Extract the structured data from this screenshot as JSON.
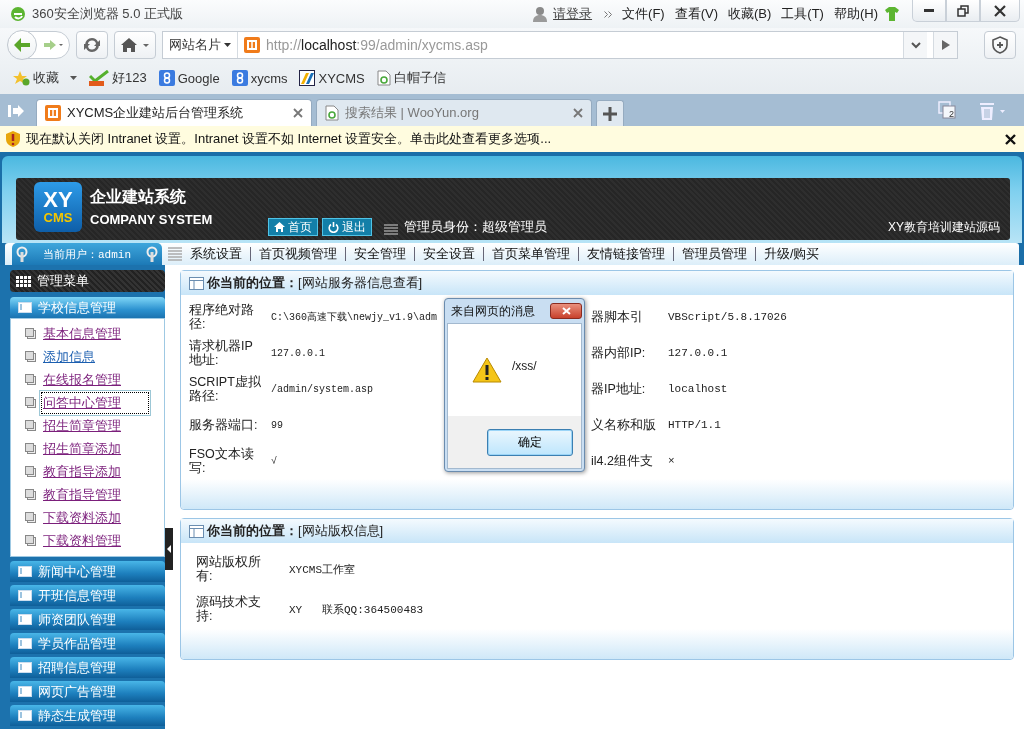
{
  "browser": {
    "title": "360安全浏览器 5.0 正式版",
    "login": "请登录",
    "menus": [
      "文件(F)",
      "查看(V)",
      "收藏(B)",
      "工具(T)",
      "帮助(H)"
    ],
    "site_card": "网站名片",
    "url": {
      "scheme": "http://",
      "host": "localhost",
      "rest": ":99/admin/xycms.asp"
    },
    "bookmarks": [
      {
        "label": "收藏",
        "kind": "favorites"
      },
      {
        "label": "好123",
        "kind": "hao"
      },
      {
        "label": "Google",
        "kind": "g"
      },
      {
        "label": "xycms",
        "kind": "g"
      },
      {
        "label": "XYCMS",
        "kind": "xy"
      },
      {
        "label": "白帽子信",
        "kind": "page"
      }
    ],
    "tabs": [
      {
        "title": "XYCMS企业建站后台管理系统",
        "selected": true,
        "kind": "xampp"
      },
      {
        "title": "搜索结果 | WooYun.org",
        "selected": false,
        "kind": "page"
      }
    ],
    "tab_count": "2",
    "infobar": "现在默认关闭 Intranet 设置。Intranet 设置不如 Internet 设置安全。单击此处查看更多选项..."
  },
  "header": {
    "logo_top": "XY",
    "logo_bottom": "CMS",
    "title": "企业建站系统",
    "subtitle": "COMPANY SYSTEM",
    "buttons": [
      {
        "label": "首页",
        "kind": "home"
      },
      {
        "label": "退出",
        "kind": "power"
      }
    ],
    "identity": "管理员身份：超级管理员",
    "right_text": "XY教育培训建站源码"
  },
  "current_user": "当前用户：admin",
  "top_menu": [
    "系统设置",
    "首页视频管理",
    "安全管理",
    "安全设置",
    "首页菜单管理",
    "友情链接管理",
    "管理员管理",
    "升级/购买"
  ],
  "sidebar": {
    "title": "管理菜单",
    "groups": [
      {
        "label": "学校信息管理",
        "expanded": true,
        "children": [
          {
            "label": "基本信息管理",
            "visited": true,
            "focused": false
          },
          {
            "label": "添加信息",
            "visited": false,
            "focused": false
          },
          {
            "label": "在线报名管理",
            "visited": true,
            "focused": false
          },
          {
            "label": "问答中心管理",
            "visited": true,
            "focused": true
          },
          {
            "label": "招生简章管理",
            "visited": true,
            "focused": false
          },
          {
            "label": "招生简章添加",
            "visited": true,
            "focused": false
          },
          {
            "label": "教育指导添加",
            "visited": true,
            "focused": false
          },
          {
            "label": "教育指导管理",
            "visited": true,
            "focused": false
          },
          {
            "label": "下载资料添加",
            "visited": true,
            "focused": false
          },
          {
            "label": "下载资料管理",
            "visited": true,
            "focused": false
          }
        ]
      },
      {
        "label": "新闻中心管理",
        "expanded": false
      },
      {
        "label": "开班信息管理",
        "expanded": false
      },
      {
        "label": "师资团队管理",
        "expanded": false
      },
      {
        "label": "学员作品管理",
        "expanded": false
      },
      {
        "label": "招聘信息管理",
        "expanded": false
      },
      {
        "label": "网页广告管理",
        "expanded": false
      },
      {
        "label": "静态生成管理",
        "expanded": false
      }
    ]
  },
  "panels": [
    {
      "title_bold": "你当前的位置：",
      "title": "[网站服务器信息查看]",
      "kind": "four",
      "rows": [
        {
          "label": "程序绝对路径:",
          "value": "C:\\360高速下载\\newjy_v1.9\\adm",
          "label_2": "器脚本引",
          "value_2": "VBScript/5.8.17026"
        },
        {
          "label": "请求机器IP地址:",
          "value": "127.0.0.1",
          "label_2": "器内部IP:",
          "value_2": "127.0.0.1"
        },
        {
          "label": "SCRIPT虚拟路径:",
          "value": "/admin/system.asp",
          "label_2": "器IP地址:",
          "value_2": "localhost"
        },
        {
          "label": "服务器端口:",
          "value": "99",
          "label_2": "义名称和版",
          "value_2": "HTTP/1.1"
        },
        {
          "label": "FSO文本读写:",
          "value": "√",
          "label_2": "il4.2组件支",
          "value_2": "×"
        }
      ]
    },
    {
      "title_bold": "你当前的位置：",
      "title": "[网站版权信息]",
      "kind": "two",
      "rows": [
        {
          "label": "网站版权所有:",
          "value": "XYCMS工作室"
        },
        {
          "label": "源码技术支持:",
          "value": "XY   联系QQ:364500483"
        }
      ]
    }
  ],
  "dialog": {
    "title": "来自网页的消息",
    "message": "/xss/",
    "button": "确定"
  }
}
